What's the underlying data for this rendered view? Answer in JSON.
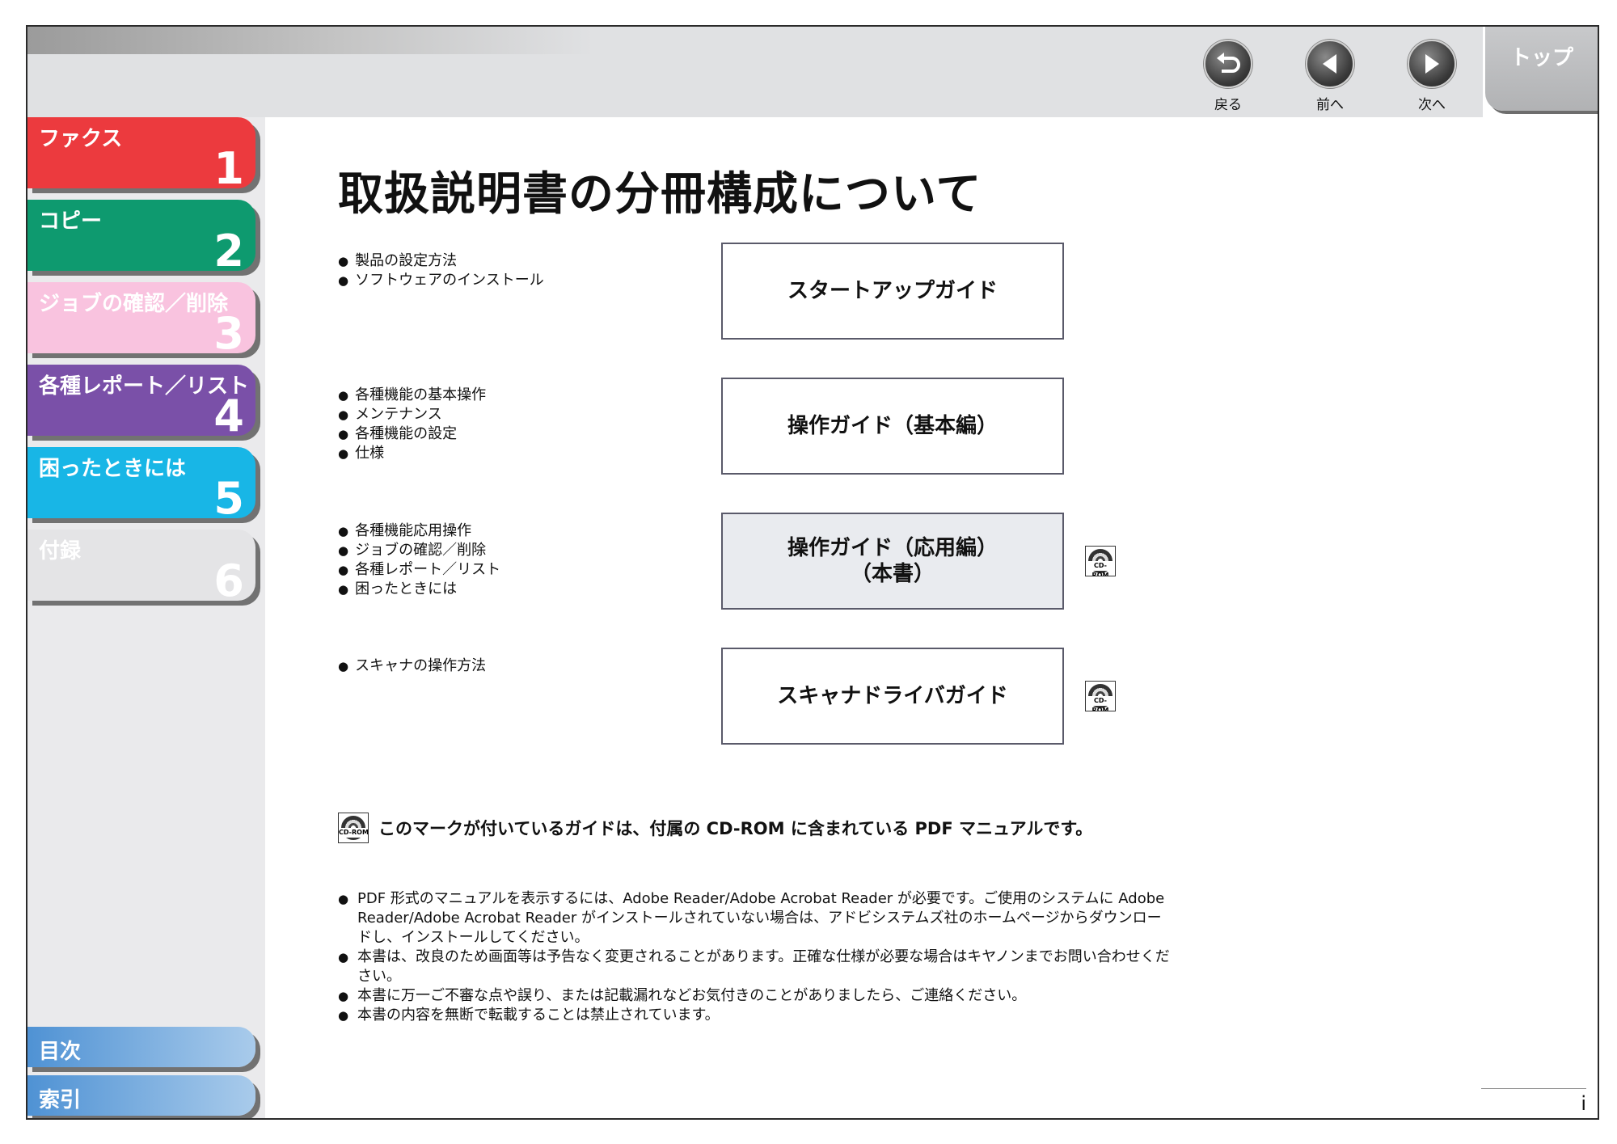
{
  "toolbar": {
    "back_label": "戻る",
    "prev_label": "前へ",
    "next_label": "次へ",
    "top_label": "トップ"
  },
  "sidebar": {
    "tabs": [
      {
        "label": "ファクス",
        "number": "1",
        "color": "#ec3a3e"
      },
      {
        "label": "コピー",
        "number": "2",
        "color": "#0e9a6f"
      },
      {
        "label": "ジョブの確認／削除",
        "number": "3",
        "color": "#f9c3df"
      },
      {
        "label": "各種レポート／リスト",
        "number": "4",
        "color": "#7a50a8"
      },
      {
        "label": "困ったときには",
        "number": "5",
        "color": "#18b6e6"
      },
      {
        "label": "付録",
        "number": "6",
        "color": "#e4e4e6"
      }
    ],
    "toc_label": "目次",
    "index_label": "索引",
    "link_color": "#4f92d4"
  },
  "page": {
    "title": "取扱説明書の分冊構成について",
    "sections": [
      {
        "bullets": [
          "製品の設定方法",
          "ソフトウェアのインストール"
        ],
        "guide_lines": [
          "スタートアップガイド"
        ],
        "cdrom": false
      },
      {
        "bullets": [
          "各種機能の基本操作",
          "メンテナンス",
          "各種機能の設定",
          "仕様"
        ],
        "guide_lines": [
          "操作ガイド（基本編）"
        ],
        "cdrom": false
      },
      {
        "bullets": [
          "各種機能応用操作",
          "ジョブの確認／削除",
          "各種レポート／リスト",
          "困ったときには"
        ],
        "guide_lines": [
          "操作ガイド（応用編）",
          "（本書）"
        ],
        "cdrom": true
      },
      {
        "bullets": [
          "スキャナの操作方法"
        ],
        "guide_lines": [
          "スキャナドライバガイド"
        ],
        "cdrom": true
      }
    ],
    "cdrom_icon_text": "CD-ROM",
    "cdrom_note": "このマークが付いているガイドは、付属の CD-ROM に含まれている PDF マニュアルです。",
    "notes": [
      "PDF 形式のマニュアルを表示するには、Adobe Reader/Adobe Acrobat Reader が必要です。ご使用のシステムに Adobe Reader/Adobe Acrobat Reader がインストールされていない場合は、アドビシステムズ社のホームページからダウンロードし、インストールしてください。",
      "本書は、改良のため画面等は予告なく変更されることがあります。正確な仕様が必要な場合はキヤノンまでお問い合わせください。",
      "本書に万一ご不審な点や誤り、または記載漏れなどお気付きのことがありましたら、ご連絡ください。",
      "本書の内容を無断で転載することは禁止されています。"
    ],
    "page_number": "i"
  }
}
